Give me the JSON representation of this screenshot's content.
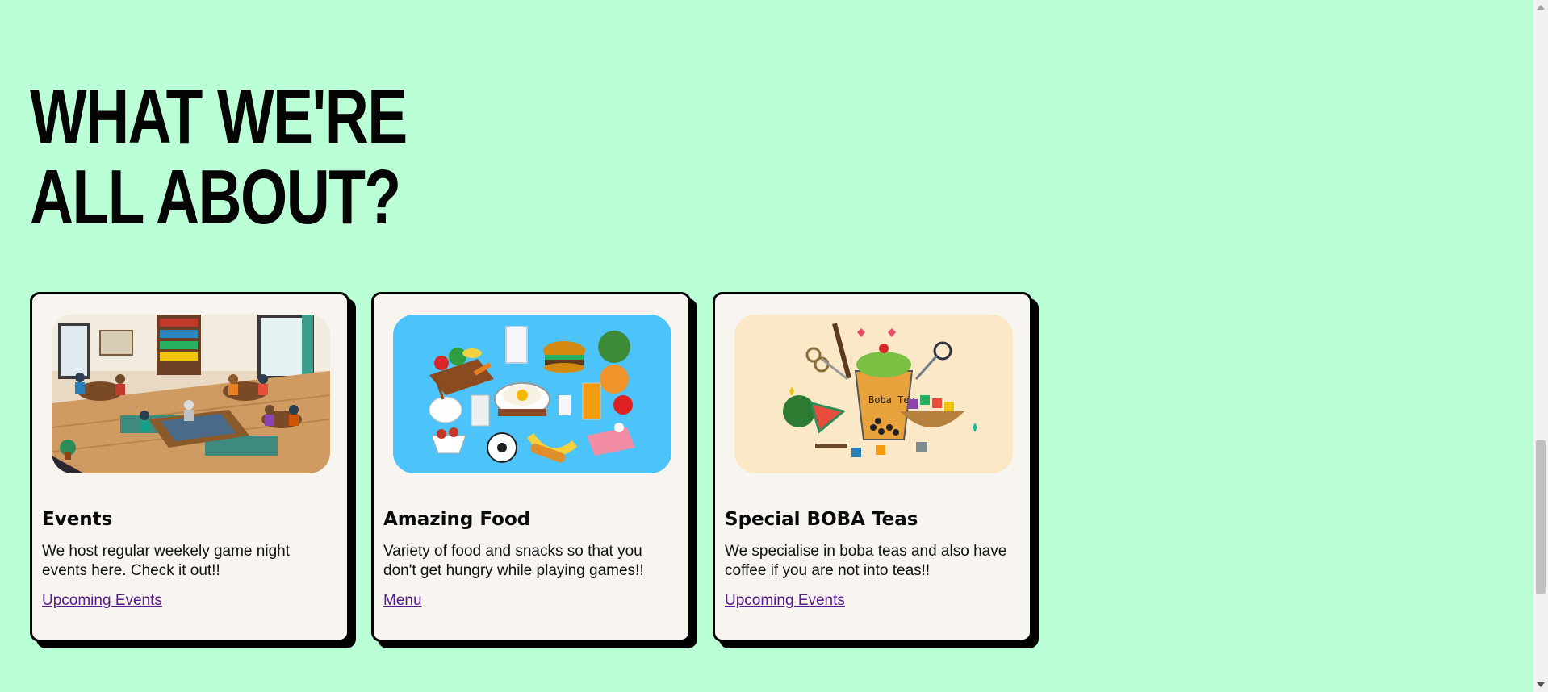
{
  "section": {
    "heading_line1": "WHAT WE'RE",
    "heading_line2": "ALL ABOUT?"
  },
  "cards": [
    {
      "title": "Events",
      "text": "We host regular weekely game night events here. Check it out!!",
      "link": "Upcoming Events",
      "image": "board-game-cafe-illustration",
      "image_bg": "#e9d9c3"
    },
    {
      "title": "Amazing Food",
      "text": "Variety of food and snacks so that you don't get hungry while playing games!!",
      "link": "Menu",
      "image": "pixel-food-illustration",
      "image_bg": "#4cc4fa"
    },
    {
      "title": "Special BOBA Teas",
      "text": "We specialise in boba teas and also have coffee if you are not into teas!!",
      "link": "Upcoming Events",
      "image": "pixel-boba-tea-illustration",
      "image_bg": "#fbe8c7"
    }
  ],
  "colors": {
    "page_bg": "#bbffd6",
    "card_bg": "#f8f4ef",
    "link": "#551a8b"
  }
}
